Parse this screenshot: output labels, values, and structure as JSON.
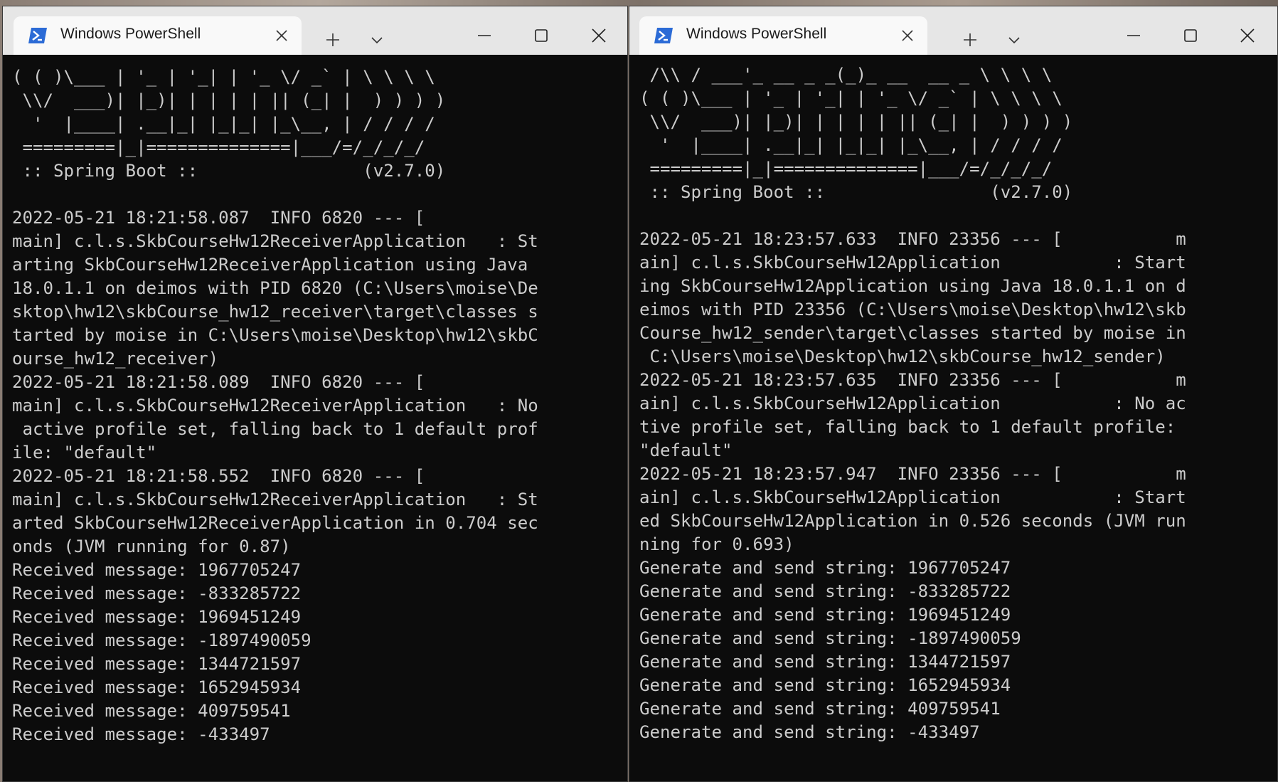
{
  "windows": [
    {
      "tab_title": "Windows PowerShell",
      "terminal_lines": [
        "( ( )\\___ | '_ | '_| | '_ \\/ _` | \\ \\ \\ \\",
        " \\\\/  ___)| |_)| | | | | || (_| |  ) ) ) )",
        "  '  |____| .__|_| |_|_| |_\\__, | / / / /",
        " =========|_|==============|___/=/_/_/_/",
        " :: Spring Boot ::                (v2.7.0)",
        "",
        "2022-05-21 18:21:58.087  INFO 6820 --- [",
        "main] c.l.s.SkbCourseHw12ReceiverApplication   : St",
        "arting SkbCourseHw12ReceiverApplication using Java",
        "18.0.1.1 on deimos with PID 6820 (C:\\Users\\moise\\De",
        "sktop\\hw12\\skbCourse_hw12_receiver\\target\\classes s",
        "tarted by moise in C:\\Users\\moise\\Desktop\\hw12\\skbC",
        "ourse_hw12_receiver)",
        "2022-05-21 18:21:58.089  INFO 6820 --- [",
        "main] c.l.s.SkbCourseHw12ReceiverApplication   : No",
        " active profile set, falling back to 1 default prof",
        "ile: \"default\"",
        "2022-05-21 18:21:58.552  INFO 6820 --- [",
        "main] c.l.s.SkbCourseHw12ReceiverApplication   : St",
        "arted SkbCourseHw12ReceiverApplication in 0.704 sec",
        "onds (JVM running for 0.87)",
        "Received message: 1967705247",
        "Received message: -833285722",
        "Received message: 1969451249",
        "Received message: -1897490059",
        "Received message: 1344721597",
        "Received message: 1652945934",
        "Received message: 409759541",
        "Received message: -433497"
      ]
    },
    {
      "tab_title": "Windows PowerShell",
      "terminal_lines": [
        " /\\\\ / ___'_ __ _ _(_)_ __  __ _ \\ \\ \\ \\",
        "( ( )\\___ | '_ | '_| | '_ \\/ _` | \\ \\ \\ \\",
        " \\\\/  ___)| |_)| | | | | || (_| |  ) ) ) )",
        "  '  |____| .__|_| |_|_| |_\\__, | / / / /",
        " =========|_|==============|___/=/_/_/_/",
        " :: Spring Boot ::                (v2.7.0)",
        "",
        "2022-05-21 18:23:57.633  INFO 23356 --- [           m",
        "ain] c.l.s.SkbCourseHw12Application           : Start",
        "ing SkbCourseHw12Application using Java 18.0.1.1 on d",
        "eimos with PID 23356 (C:\\Users\\moise\\Desktop\\hw12\\skb",
        "Course_hw12_sender\\target\\classes started by moise in",
        " C:\\Users\\moise\\Desktop\\hw12\\skbCourse_hw12_sender)",
        "2022-05-21 18:23:57.635  INFO 23356 --- [           m",
        "ain] c.l.s.SkbCourseHw12Application           : No ac",
        "tive profile set, falling back to 1 default profile:",
        "\"default\"",
        "2022-05-21 18:23:57.947  INFO 23356 --- [           m",
        "ain] c.l.s.SkbCourseHw12Application           : Start",
        "ed SkbCourseHw12Application in 0.526 seconds (JVM run",
        "ning for 0.693)",
        "Generate and send string: 1967705247",
        "Generate and send string: -833285722",
        "Generate and send string: 1969451249",
        "Generate and send string: -1897490059",
        "Generate and send string: 1344721597",
        "Generate and send string: 1652945934",
        "Generate and send string: 409759541",
        "Generate and send string: -433497"
      ]
    }
  ],
  "icons": {
    "tab": "powershell-icon",
    "close_tab": "close-icon",
    "new_tab": "plus-icon",
    "dropdown": "chevron-down-icon",
    "minimize": "minimize-icon",
    "maximize": "maximize-icon",
    "close": "close-icon"
  },
  "colors": {
    "terminal_bg": "#0c0c0c",
    "terminal_text": "#cccccc",
    "titlebar_bg": "#e6e6e6",
    "tab_bg": "#f9f9f9",
    "powershell_icon": "#2b6bd6"
  }
}
